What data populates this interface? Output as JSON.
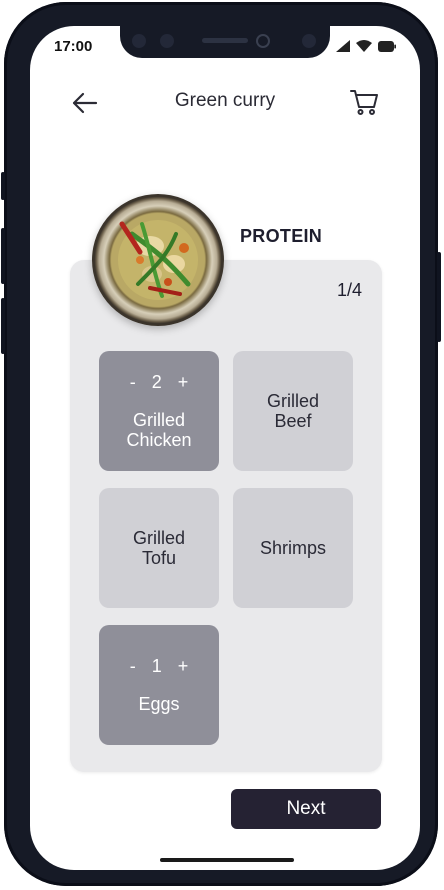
{
  "status_bar": {
    "time": "17:00"
  },
  "header": {
    "title": "Green curry"
  },
  "category": {
    "title": "PROTEIN",
    "progress": "1/4"
  },
  "options": [
    {
      "label_line1": "Grilled",
      "label_line2": "Chicken",
      "selected": true,
      "quantity": "2",
      "minus": "-",
      "plus": "+"
    },
    {
      "label_line1": "Grilled",
      "label_line2": "Beef",
      "selected": false
    },
    {
      "label_line1": "Grilled",
      "label_line2": "Tofu",
      "selected": false
    },
    {
      "label_line1": "Shrimps",
      "selected": false
    },
    {
      "label_line1": "Eggs",
      "selected": true,
      "quantity": "1",
      "minus": "-",
      "plus": "+"
    }
  ],
  "footer": {
    "next_label": "Next"
  },
  "icons": {
    "back": "arrow-left-icon",
    "cart": "shopping-cart-icon",
    "signal": "signal-icon",
    "wifi": "wifi-icon",
    "battery": "battery-icon"
  },
  "colors": {
    "selected_tile": "#8f8f99",
    "unselected_tile": "#d0d0d5",
    "panel": "#e9e9eb",
    "next_button": "#252233"
  }
}
